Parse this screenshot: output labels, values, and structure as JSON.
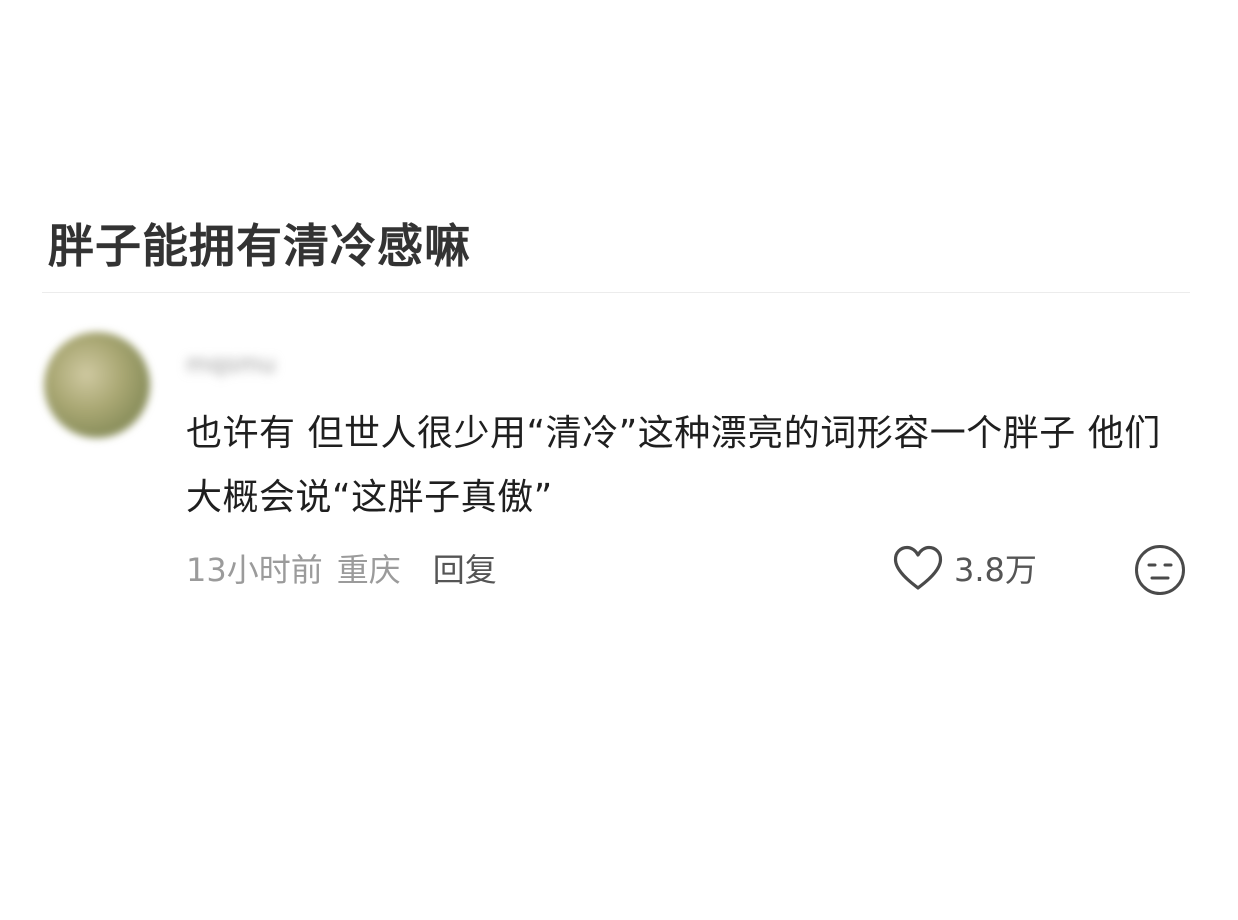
{
  "post": {
    "title": "胖子能拥有清冷感嘛"
  },
  "comment": {
    "username": "mqsmu",
    "text": "也许有 但世人很少用“清冷”这种漂亮的词形容一个胖子 他们大概会说“这胖子真傲”",
    "time": "13小时前",
    "location": "重庆",
    "reply_label": "回复",
    "like_count": "3.8万",
    "icons": {
      "like": "heart-outline-icon",
      "reaction": "neutral-face-icon"
    }
  }
}
